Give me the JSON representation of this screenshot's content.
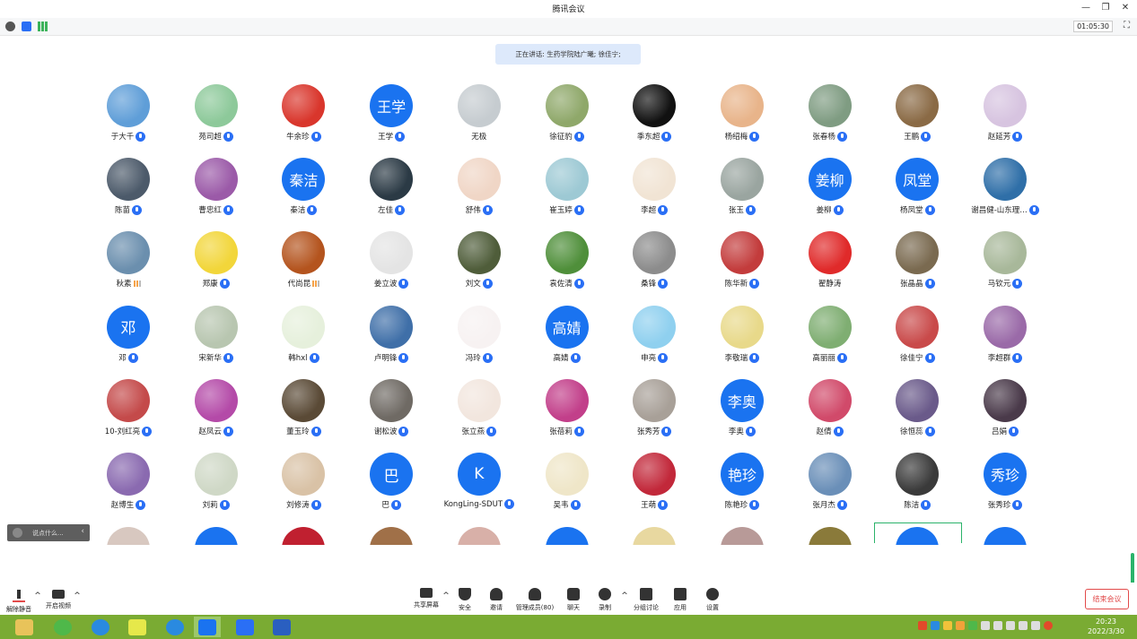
{
  "window": {
    "title": "腾讯会议"
  },
  "timer": "01:05:30",
  "speaking": "正在讲话: 生药学院陆广曦; 徐佳宁;",
  "participants": [
    {
      "name": "于大千",
      "kind": "photo",
      "color": "#5f9ed8",
      "status": "mic"
    },
    {
      "name": "苑司超",
      "kind": "photo",
      "color": "#8dc99a",
      "status": "mic"
    },
    {
      "name": "牛余珍",
      "kind": "photo",
      "color": "#d9362c",
      "status": "mic"
    },
    {
      "name": "王学",
      "kind": "text",
      "text": "王学",
      "status": "mic"
    },
    {
      "name": "无极",
      "kind": "photo",
      "color": "#c6ccd0",
      "status": "none"
    },
    {
      "name": "徐征豹",
      "kind": "photo",
      "color": "#8fa86a",
      "status": "mic"
    },
    {
      "name": "季东超",
      "kind": "photo",
      "color": "#111111",
      "status": "mic"
    },
    {
      "name": "杨绍梅",
      "kind": "photo",
      "color": "#e8b48a",
      "status": "mic"
    },
    {
      "name": "张春杨",
      "kind": "photo",
      "color": "#7f9c82",
      "status": "mic"
    },
    {
      "name": "王鹏",
      "kind": "photo",
      "color": "#8a6a45",
      "status": "mic"
    },
    {
      "name": "赵延芳",
      "kind": "photo",
      "color": "#d7c4e0",
      "status": "mic"
    },
    {
      "name": "陈苗",
      "kind": "photo",
      "color": "#4c5a6a",
      "status": "mic"
    },
    {
      "name": "曹忠红",
      "kind": "photo",
      "color": "#9b5aa8",
      "status": "mic"
    },
    {
      "name": "秦洁",
      "kind": "text",
      "text": "秦洁",
      "status": "mic"
    },
    {
      "name": "左佳",
      "kind": "photo",
      "color": "#2b3a45",
      "status": "mic"
    },
    {
      "name": "舒伟",
      "kind": "photo",
      "color": "#f0d6c6",
      "status": "mic"
    },
    {
      "name": "崔玉婷",
      "kind": "photo",
      "color": "#9dc9d4",
      "status": "mic"
    },
    {
      "name": "李超",
      "kind": "photo",
      "color": "#f1e4d4",
      "status": "mic"
    },
    {
      "name": "张玉",
      "kind": "photo",
      "color": "#9aa5a0",
      "status": "mic"
    },
    {
      "name": "姜柳",
      "kind": "text",
      "text": "姜柳",
      "status": "mic"
    },
    {
      "name": "杨凤堂",
      "kind": "text",
      "text": "凤堂",
      "status": "mic"
    },
    {
      "name": "谢昌健-山东理…",
      "kind": "photo",
      "color": "#2f6fa8",
      "status": "mic"
    },
    {
      "name": "秋素",
      "kind": "photo",
      "color": "#6b8fae",
      "status": "signal"
    },
    {
      "name": "郑康",
      "kind": "photo",
      "color": "#f2d63a",
      "status": "mic"
    },
    {
      "name": "代尚昆",
      "kind": "photo",
      "color": "#b4541e",
      "status": "signal"
    },
    {
      "name": "姜立波",
      "kind": "photo",
      "color": "#e4e4e4",
      "status": "mic"
    },
    {
      "name": "刘文",
      "kind": "photo",
      "color": "#4f5d3a",
      "status": "mic"
    },
    {
      "name": "袁佐清",
      "kind": "photo",
      "color": "#4f8f3a",
      "status": "mic"
    },
    {
      "name": "桑锋",
      "kind": "photo",
      "color": "#8c8c8c",
      "status": "mic"
    },
    {
      "name": "陈华新",
      "kind": "photo",
      "color": "#c33c3c",
      "status": "mic"
    },
    {
      "name": "翟静涛",
      "kind": "photo",
      "color": "#e02a2a",
      "status": "none"
    },
    {
      "name": "张晶晶",
      "kind": "photo",
      "color": "#7a6a50",
      "status": "mic"
    },
    {
      "name": "马钦元",
      "kind": "photo",
      "color": "#a8b89a",
      "status": "mic"
    },
    {
      "name": "邓",
      "kind": "text",
      "text": "邓",
      "status": "mic"
    },
    {
      "name": "宋新华",
      "kind": "photo",
      "color": "#b8c6b0",
      "status": "mic"
    },
    {
      "name": "韩hxl",
      "kind": "photo",
      "color": "#e6f0dc",
      "status": "mic"
    },
    {
      "name": "卢明锋",
      "kind": "photo",
      "color": "#3f6fa8",
      "status": "mic"
    },
    {
      "name": "冯玲",
      "kind": "photo",
      "color": "#f7f2f2",
      "status": "mic"
    },
    {
      "name": "高婧",
      "kind": "text",
      "text": "高婧",
      "status": "mic"
    },
    {
      "name": "申亮",
      "kind": "photo",
      "color": "#8fd0ef",
      "status": "mic"
    },
    {
      "name": "李敬瑞",
      "kind": "photo",
      "color": "#e8d98a",
      "status": "mic"
    },
    {
      "name": "高丽丽",
      "kind": "photo",
      "color": "#7fae72",
      "status": "mic"
    },
    {
      "name": "徐佳宁",
      "kind": "photo",
      "color": "#c94a4a",
      "status": "mic"
    },
    {
      "name": "李超群",
      "kind": "photo",
      "color": "#9a6aa8",
      "status": "mic"
    },
    {
      "name": "10-刘红亮",
      "kind": "photo",
      "color": "#c44a4a",
      "status": "mic"
    },
    {
      "name": "赵凤云",
      "kind": "photo",
      "color": "#b44aa8",
      "status": "mic"
    },
    {
      "name": "董玉玲",
      "kind": "photo",
      "color": "#5a4a36",
      "status": "mic"
    },
    {
      "name": "谢松波",
      "kind": "photo",
      "color": "#6f6a64",
      "status": "mic"
    },
    {
      "name": "张立燕",
      "kind": "photo",
      "color": "#f2e6de",
      "status": "mic"
    },
    {
      "name": "张蓓莉",
      "kind": "photo",
      "color": "#c23f8a",
      "status": "mic"
    },
    {
      "name": "张秀芳",
      "kind": "photo",
      "color": "#a8a098",
      "status": "mic"
    },
    {
      "name": "李奥",
      "kind": "text",
      "text": "李奥",
      "status": "mic"
    },
    {
      "name": "赵倩",
      "kind": "photo",
      "color": "#d14a6a",
      "status": "mic"
    },
    {
      "name": "徐恒蕊",
      "kind": "photo",
      "color": "#6a5a8a",
      "status": "mic"
    },
    {
      "name": "吕娟",
      "kind": "photo",
      "color": "#4a3a4a",
      "status": "mic"
    },
    {
      "name": "赵博生",
      "kind": "photo",
      "color": "#8a6ab0",
      "status": "mic"
    },
    {
      "name": "刘莉",
      "kind": "photo",
      "color": "#cfd8c6",
      "status": "mic"
    },
    {
      "name": "刘修涛",
      "kind": "photo",
      "color": "#d9c2a6",
      "status": "mic"
    },
    {
      "name": "巴",
      "kind": "text",
      "text": "巴",
      "status": "mic"
    },
    {
      "name": "KongLing-SDUT",
      "kind": "text",
      "text": "K",
      "status": "mic"
    },
    {
      "name": "吴韦",
      "kind": "photo",
      "color": "#efe6c8",
      "status": "mic"
    },
    {
      "name": "王萌",
      "kind": "photo",
      "color": "#c2283a",
      "status": "mic"
    },
    {
      "name": "陈艳珍",
      "kind": "text",
      "text": "艳珍",
      "status": "mic"
    },
    {
      "name": "张月杰",
      "kind": "photo",
      "color": "#6a8fb8",
      "status": "mic"
    },
    {
      "name": "陈洁",
      "kind": "photo",
      "color": "#3a3a3a",
      "status": "mic"
    },
    {
      "name": "张秀珍",
      "kind": "text",
      "text": "秀珍",
      "status": "mic"
    }
  ],
  "partial_row_colors": [
    "#d8c8c0",
    "#1a73f0",
    "#c02030",
    "#a07048",
    "#d8b0a8",
    "#1a73f0",
    "#e8d8a0",
    "#b89a98",
    "#8a7a3a",
    "#1a73f0",
    "#1a73f0"
  ],
  "chat_input": {
    "placeholder": "说点什么..."
  },
  "toolbar": {
    "unmute": "解除静音",
    "video": "开启视频",
    "share": "共享屏幕",
    "security": "安全",
    "invite": "邀请",
    "members": "管理成员(80)",
    "chat": "聊天",
    "record": "录制",
    "breakout": "分组讨论",
    "apps": "应用",
    "settings": "设置",
    "end": "结束会议"
  },
  "taskbar_clock": {
    "time": "20:23",
    "date": "2022/3/30"
  }
}
